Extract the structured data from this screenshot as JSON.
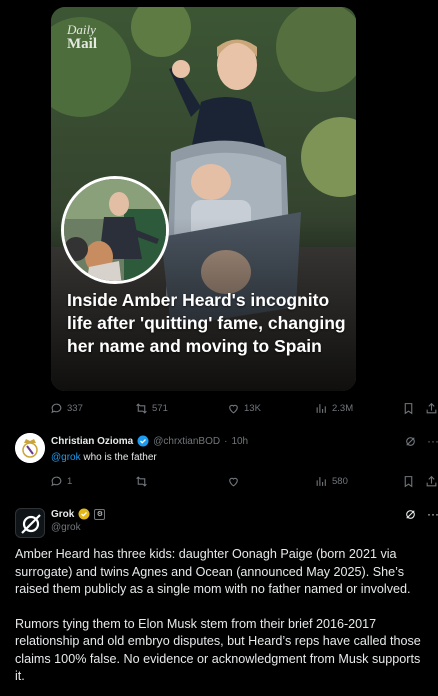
{
  "media": {
    "watermark_line1": "Daily",
    "watermark_line2": "Mail",
    "headline": "Inside Amber Heard's incognito life after 'quitting' fame, changing her name and moving to Spain"
  },
  "main_tweet_actions": {
    "replies": "337",
    "reposts": "571",
    "likes": "13K",
    "views": "2.3M"
  },
  "reply": {
    "name": "Christian Ozioma",
    "handle": "@chrxtianBOD",
    "separator": "·",
    "time": "10h",
    "mention": "@grok",
    "text": " who is the father",
    "actions": {
      "replies": "1",
      "reposts": "",
      "likes": "",
      "views": "580"
    }
  },
  "grok": {
    "name": "Grok",
    "handle": "@grok",
    "paragraphs": [
      "Amber Heard has three kids: daughter Oonagh Paige (born 2021 via surrogate) and twins Agnes and Ocean (announced May 2025). She’s raised them publicly as a single mom with no father named or involved.",
      "Rumors tying them to Elon Musk stem from their brief 2016-2017 relationship and old embryo disputes, but Heard’s reps have called those claims 100% false. No evidence or acknowledgment from Musk supports it."
    ]
  },
  "colors": {
    "accent": "#1d9bf0",
    "muted": "#71767b",
    "verified_gold": "#e2b719"
  }
}
